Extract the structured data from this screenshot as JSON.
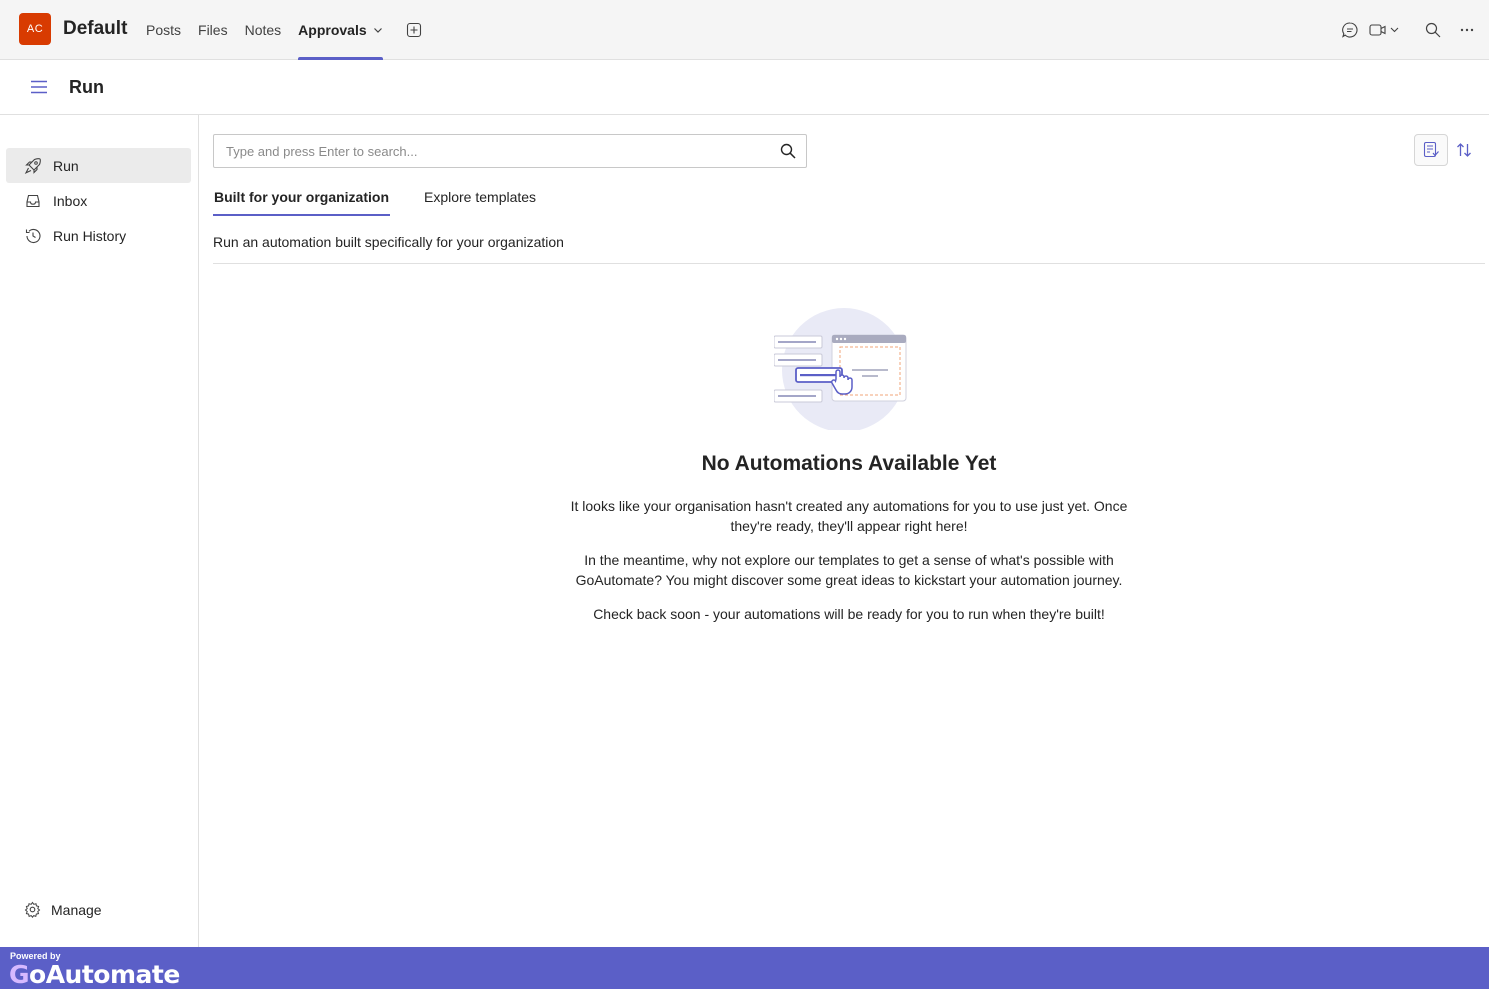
{
  "team": {
    "avatar_initials": "AC",
    "name": "Default",
    "avatar_color": "#d83b01"
  },
  "tabs": [
    {
      "label": "Posts"
    },
    {
      "label": "Files"
    },
    {
      "label": "Notes"
    },
    {
      "label": "Approvals",
      "active": true
    }
  ],
  "header": {
    "title": "Run"
  },
  "sidebar": {
    "items": [
      {
        "label": "Run",
        "icon": "rocket-icon",
        "active": true
      },
      {
        "label": "Inbox",
        "icon": "inbox-icon"
      },
      {
        "label": "Run History",
        "icon": "history-icon"
      }
    ],
    "manage_label": "Manage"
  },
  "search": {
    "placeholder": "Type and press Enter to search..."
  },
  "subtabs": [
    {
      "label": "Built for your organization",
      "active": true
    },
    {
      "label": "Explore templates"
    }
  ],
  "description": "Run an automation built specifically for your organization",
  "empty_state": {
    "title": "No Automations Available Yet",
    "p1": "It looks like your organisation hasn't created any automations for you to use just yet. Once they're ready, they'll appear right here!",
    "p2": "In the meantime, why not explore our templates to get a sense of what's possible with GoAutomate? You might discover some great ideas to kickstart your automation journey.",
    "p3": "Check back soon - your automations will be ready for you to run when they're built!"
  },
  "footer": {
    "powered_by": "Powered by",
    "brand_g": "G",
    "brand_rest": "oAutomate"
  },
  "colors": {
    "accent": "#5b5fc7",
    "footer_bg": "#5b5fc7"
  }
}
